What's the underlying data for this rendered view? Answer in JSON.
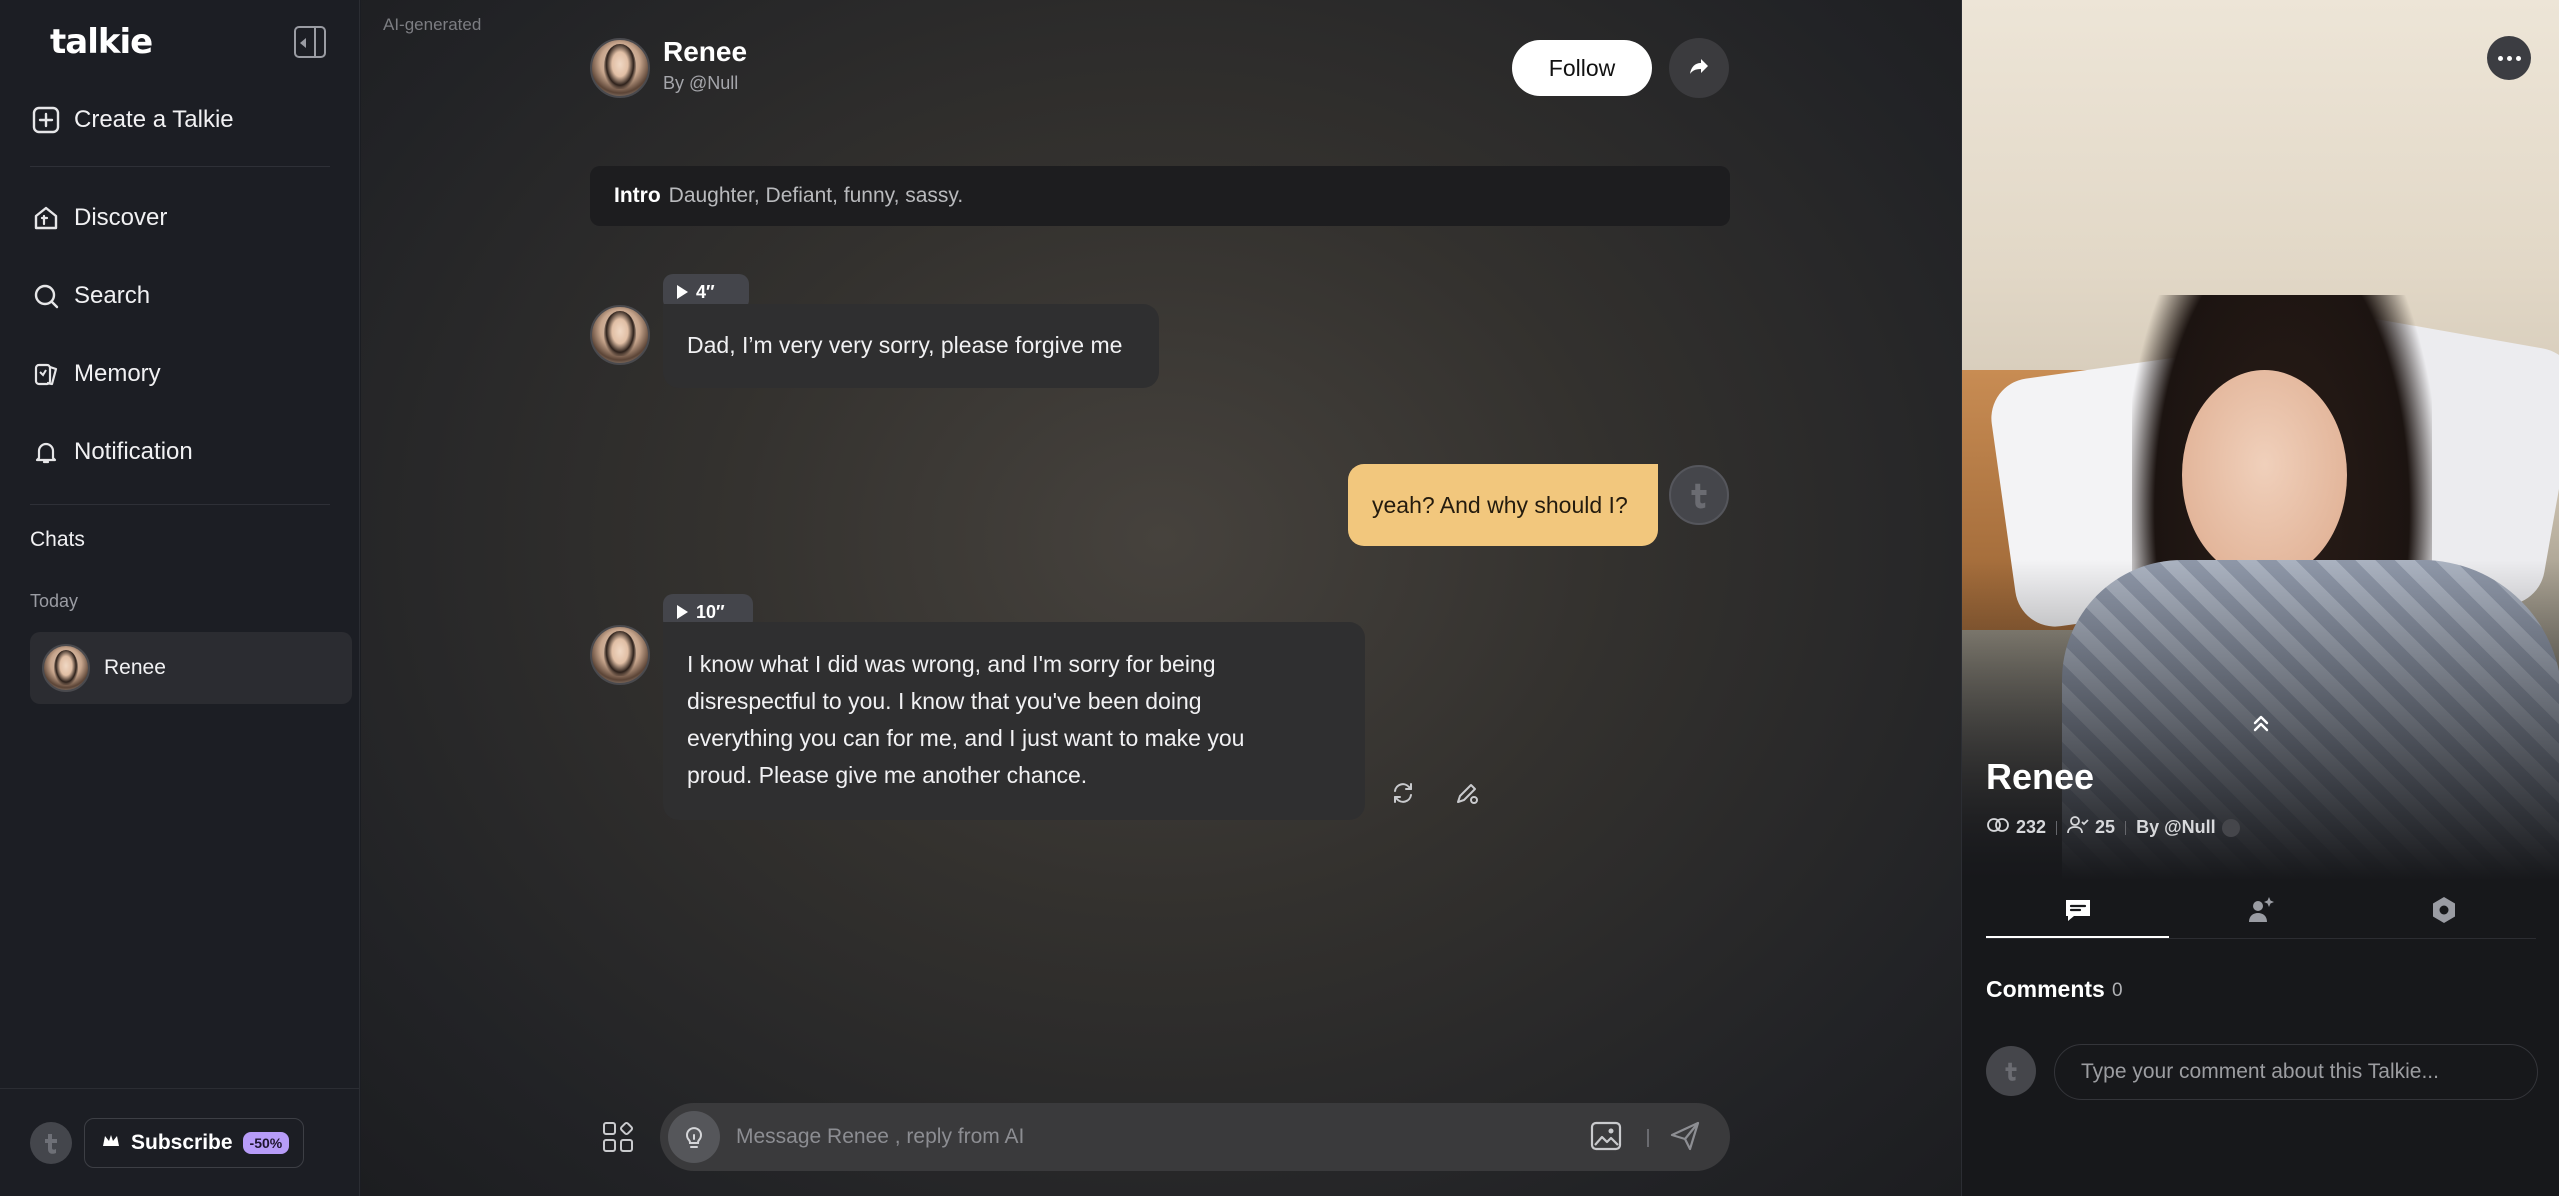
{
  "app": {
    "logo": "talkie",
    "ai_label": "AI-generated"
  },
  "sidebar": {
    "create_label": "Create a Talkie",
    "items": [
      {
        "label": "Discover",
        "icon": "home-t-icon"
      },
      {
        "label": "Search",
        "icon": "search-icon"
      },
      {
        "label": "Memory",
        "icon": "memory-cards-icon"
      },
      {
        "label": "Notification",
        "icon": "bell-icon"
      }
    ],
    "chats_title": "Chats",
    "today_label": "Today",
    "chats": [
      {
        "name": "Renee"
      }
    ],
    "subscribe_label": "Subscribe",
    "discount": "-50%"
  },
  "chat": {
    "character_name": "Renee",
    "by": "By @Null",
    "follow_label": "Follow",
    "intro_label": "Intro",
    "intro_text": "Daughter, Defiant, funny, sassy.",
    "messages": [
      {
        "role": "ai",
        "audio": "4″",
        "text": "Dad, I’m very very sorry, please forgive me"
      },
      {
        "role": "user",
        "text": "yeah? And why should I?"
      },
      {
        "role": "ai",
        "audio": "10″",
        "lines": [
          "I know what I did was wrong, and I'm sorry for being",
          "disrespectful to you. I know that you've been doing",
          "everything you can for me, and I just want to make you",
          "proud. Please give me another chance."
        ]
      }
    ],
    "input_placeholder": "Message Renee , reply from AI"
  },
  "profile": {
    "name": "Renee",
    "views": "232",
    "followers": "25",
    "by": "By @Null",
    "comments_title": "Comments",
    "comments_count": "0",
    "comment_placeholder": "Type your comment about this Talkie..."
  },
  "colors": {
    "user_bubble": "#f2c77d",
    "ai_bubble": "#2f2f30",
    "discount_badge": "#b79cf8"
  }
}
